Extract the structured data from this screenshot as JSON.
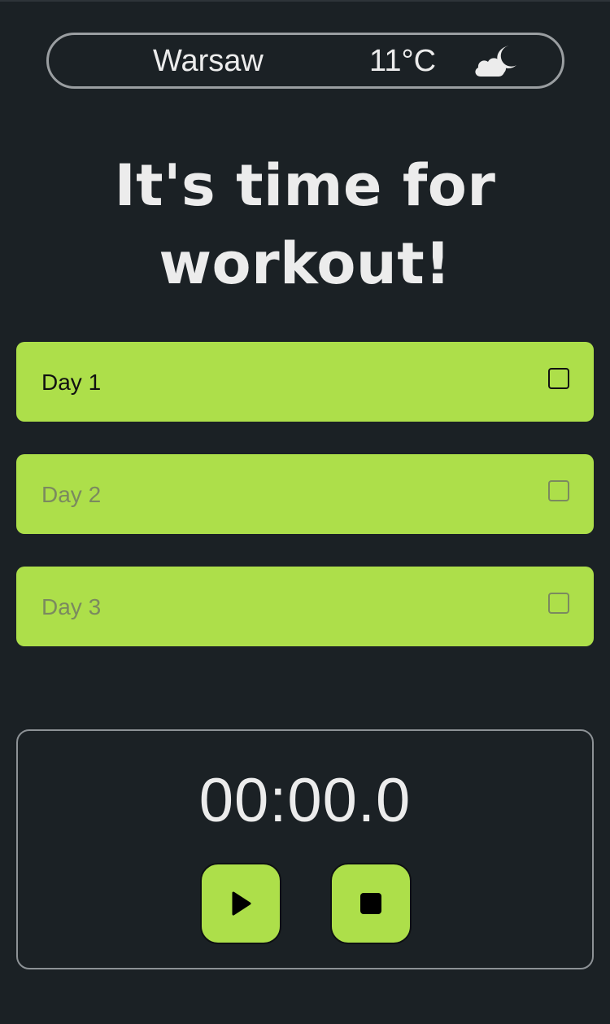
{
  "weather": {
    "city": "Warsaw",
    "temperature": "11°C",
    "icon": "cloud-moon-icon"
  },
  "heading": {
    "line1": "It's time for",
    "line2": "workout!"
  },
  "days": [
    {
      "label": "Day 1",
      "checked": false,
      "state": "active"
    },
    {
      "label": "Day 2",
      "checked": false,
      "state": "muted"
    },
    {
      "label": "Day 3",
      "checked": false,
      "state": "muted"
    }
  ],
  "timer": {
    "display": "00:00.0",
    "play_icon": "play-icon",
    "stop_icon": "stop-icon"
  },
  "colors": {
    "background": "#1b2125",
    "accent": "#addf4a",
    "text": "#ececec",
    "muted_text": "#7b8a5f"
  }
}
